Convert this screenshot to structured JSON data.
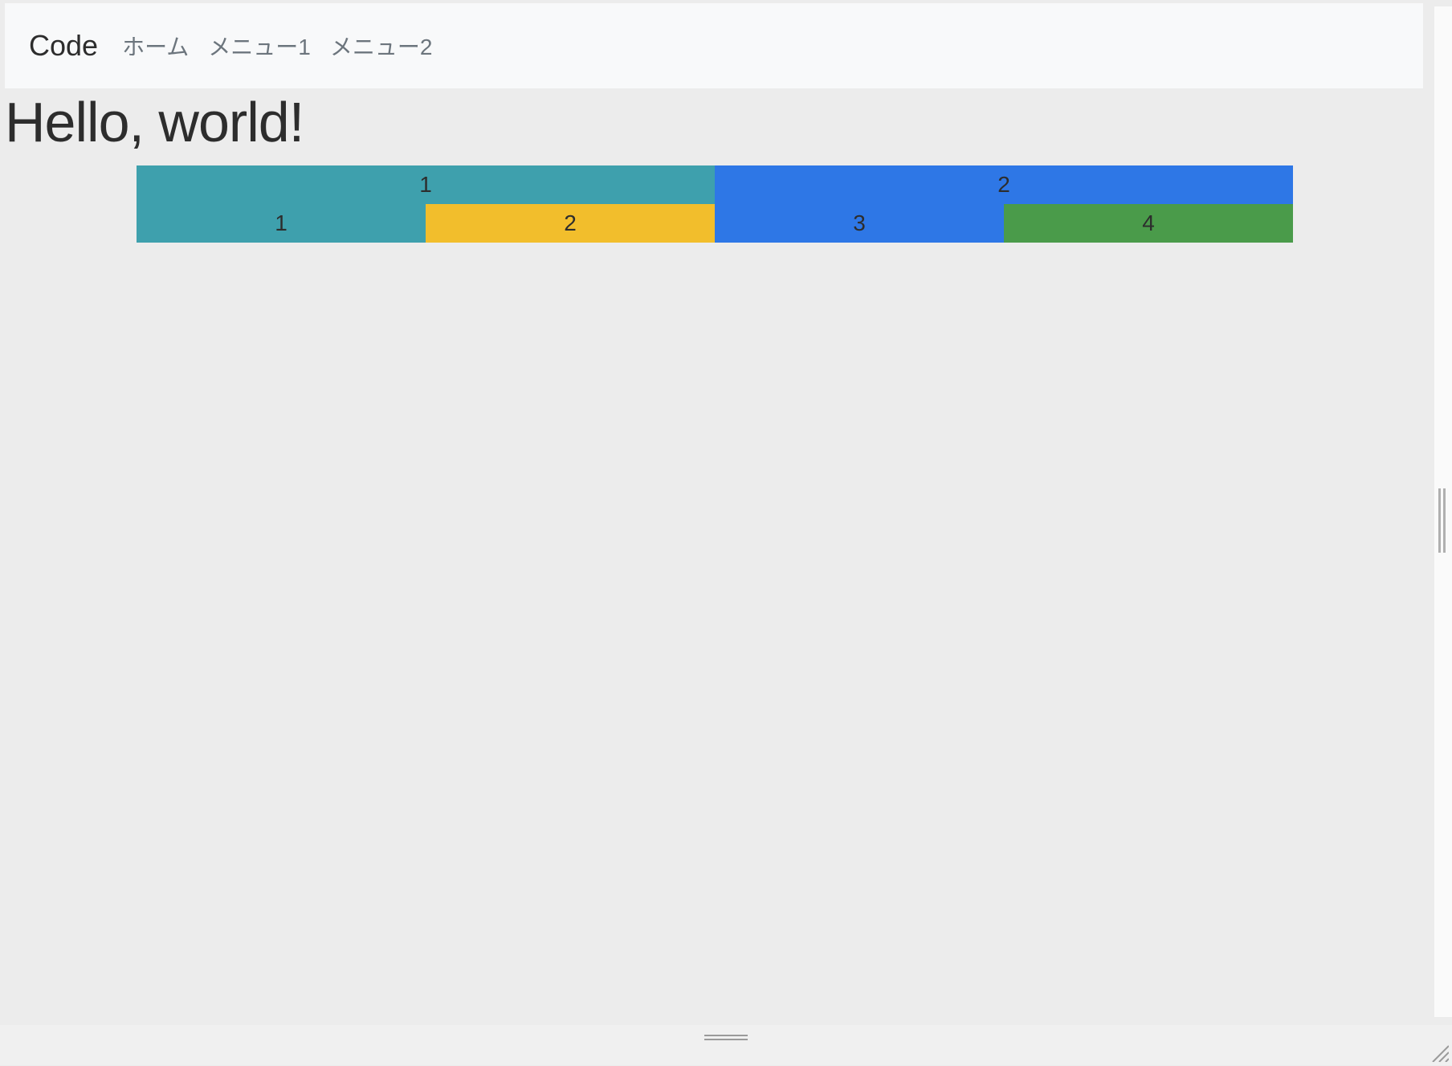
{
  "navbar": {
    "brand": "Code",
    "links": [
      "ホーム",
      "メニュー1",
      "メニュー2"
    ]
  },
  "heading": "Hello, world!",
  "grid": {
    "row1": [
      {
        "label": "1",
        "color": "teal"
      },
      {
        "label": "2",
        "color": "blue"
      }
    ],
    "row2": [
      {
        "label": "1",
        "color": "teal"
      },
      {
        "label": "2",
        "color": "yellow"
      },
      {
        "label": "3",
        "color": "blue"
      },
      {
        "label": "4",
        "color": "green"
      }
    ]
  },
  "colors": {
    "teal": "#3ea0ad",
    "blue": "#2e77e6",
    "yellow": "#f2be2c",
    "green": "#4a9b4a"
  }
}
